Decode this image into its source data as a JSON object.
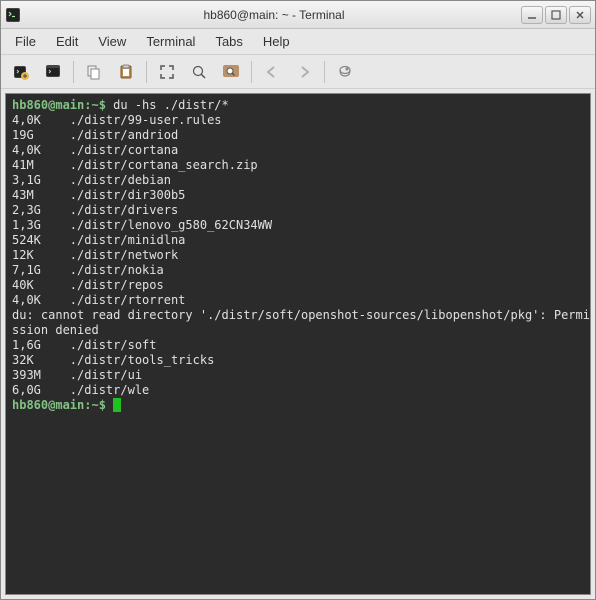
{
  "window": {
    "title": "hb860@main: ~ - Terminal"
  },
  "menu": {
    "file": "File",
    "edit": "Edit",
    "view": "View",
    "terminal": "Terminal",
    "tabs": "Tabs",
    "help": "Help"
  },
  "terminal": {
    "prompt1": "hb860@main:~$ ",
    "command1": "du -hs ./distr/*",
    "lines": [
      "4,0K    ./distr/99-user.rules",
      "19G     ./distr/andriod",
      "4,0K    ./distr/cortana",
      "41M     ./distr/cortana_search.zip",
      "3,1G    ./distr/debian",
      "43M     ./distr/dir300b5",
      "2,3G    ./distr/drivers",
      "1,3G    ./distr/lenovo_g580_62CN34WW",
      "524K    ./distr/minidlna",
      "12K     ./distr/network",
      "7,1G    ./distr/nokia",
      "40K     ./distr/repos",
      "4,0K    ./distr/rtorrent",
      "du: cannot read directory './distr/soft/openshot-sources/libopenshot/pkg': Permi",
      "ssion denied",
      "1,6G    ./distr/soft",
      "32K     ./distr/tools_tricks",
      "393M    ./distr/ui",
      "6,0G    ./distr/wle"
    ],
    "prompt2": "hb860@main:~$ "
  }
}
